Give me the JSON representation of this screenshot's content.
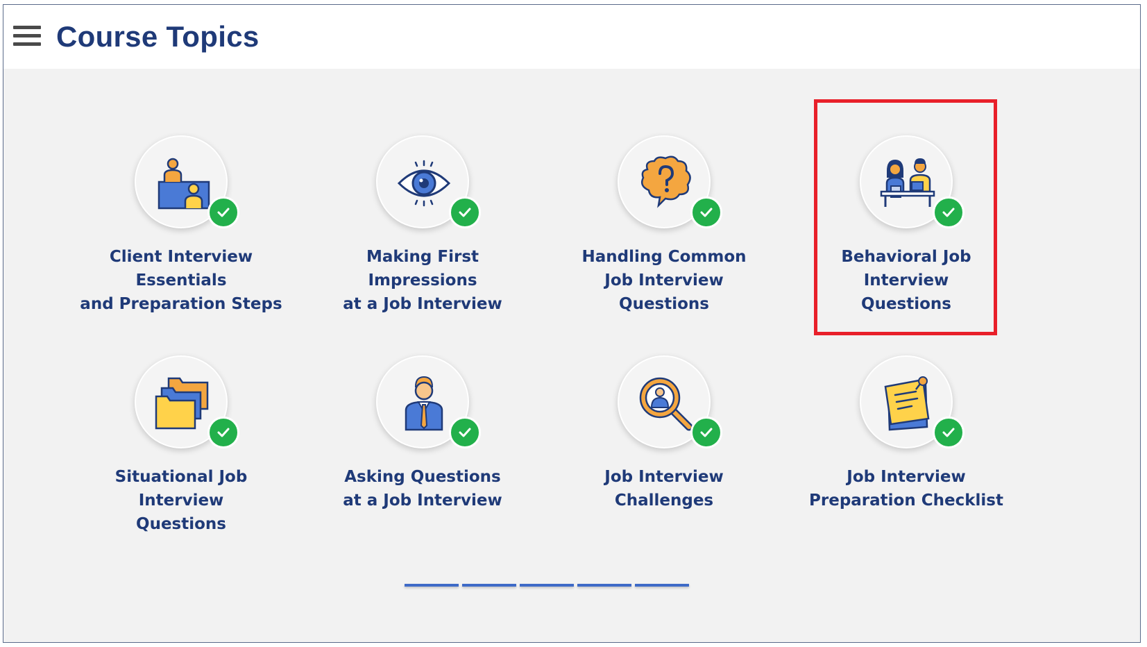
{
  "header": {
    "title": "Course Topics",
    "menu_icon": "hamburger-menu-icon"
  },
  "topics": [
    {
      "lines": [
        "Client Interview",
        "Essentials",
        "and Preparation Steps"
      ],
      "icon": "client-interview-icon",
      "completed": true
    },
    {
      "lines": [
        "Making First",
        "Impressions",
        "at a Job Interview"
      ],
      "icon": "eye-icon",
      "completed": true
    },
    {
      "lines": [
        "Handling Common",
        "Job Interview",
        "Questions"
      ],
      "icon": "question-bubble-icon",
      "completed": true
    },
    {
      "lines": [
        "Behavioral Job",
        "Interview",
        "Questions"
      ],
      "icon": "interview-desk-icon",
      "completed": true
    },
    {
      "lines": [
        "Situational Job",
        "Interview",
        "Questions"
      ],
      "icon": "folders-icon",
      "completed": true
    },
    {
      "lines": [
        "Asking Questions",
        "at a Job Interview"
      ],
      "icon": "businessman-icon",
      "completed": true
    },
    {
      "lines": [
        "Job Interview",
        "Challenges"
      ],
      "icon": "magnifier-person-icon",
      "completed": true
    },
    {
      "lines": [
        "Job Interview",
        "Preparation Checklist"
      ],
      "icon": "sticky-note-icon",
      "completed": true
    }
  ],
  "highlighted_topic": "Behavioral Job Interview Questions",
  "colors": {
    "title": "#1f3a78",
    "check": "#22b04b",
    "highlight": "#e8202a",
    "pager": "#3f6bc7",
    "background": "#f2f2f2"
  },
  "pager": {
    "segments": 5
  }
}
